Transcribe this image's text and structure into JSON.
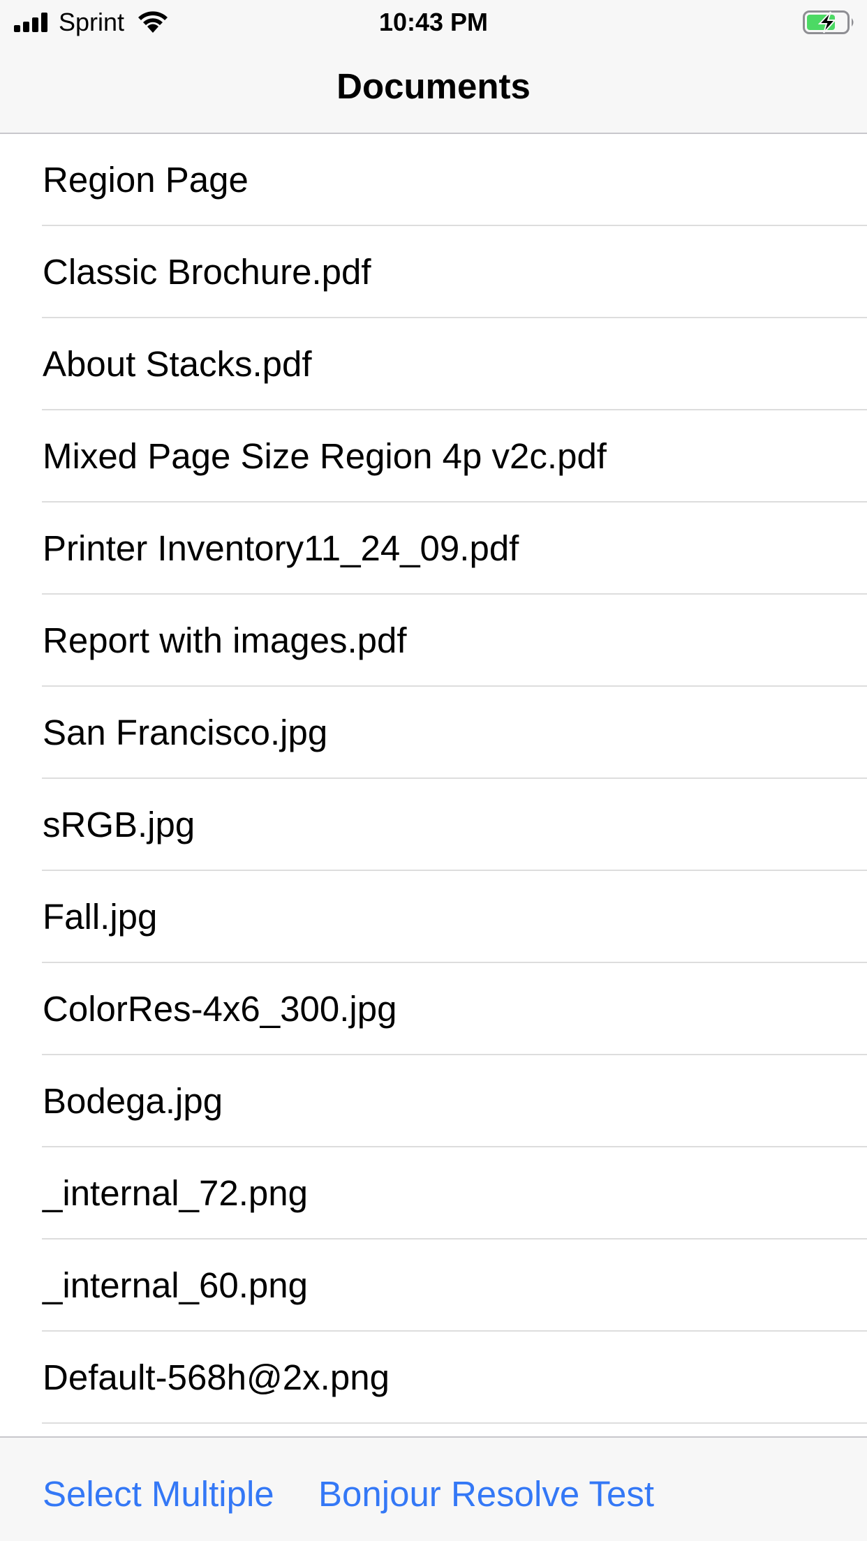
{
  "status_bar": {
    "carrier": "Sprint",
    "time": "10:43 PM",
    "signal_icon": "cellular-signal-icon",
    "wifi_icon": "wifi-icon",
    "battery_icon": "battery-charging-icon",
    "battery_color": "#4cd964"
  },
  "nav": {
    "title": "Documents"
  },
  "documents": [
    {
      "name": "Region Page"
    },
    {
      "name": "Classic Brochure.pdf"
    },
    {
      "name": "About Stacks.pdf"
    },
    {
      "name": "Mixed Page Size Region 4p v2c.pdf"
    },
    {
      "name": "Printer Inventory11_24_09.pdf"
    },
    {
      "name": "Report with images.pdf"
    },
    {
      "name": "San Francisco.jpg"
    },
    {
      "name": "sRGB.jpg"
    },
    {
      "name": "Fall.jpg"
    },
    {
      "name": "ColorRes-4x6_300.jpg"
    },
    {
      "name": "Bodega.jpg"
    },
    {
      "name": "_internal_72.png"
    },
    {
      "name": "_internal_60.png"
    },
    {
      "name": "Default-568h@2x.png"
    }
  ],
  "toolbar": {
    "select_multiple": "Select Multiple",
    "bonjour_resolve_test": "Bonjour Resolve Test",
    "accent_color": "#3478f6"
  }
}
